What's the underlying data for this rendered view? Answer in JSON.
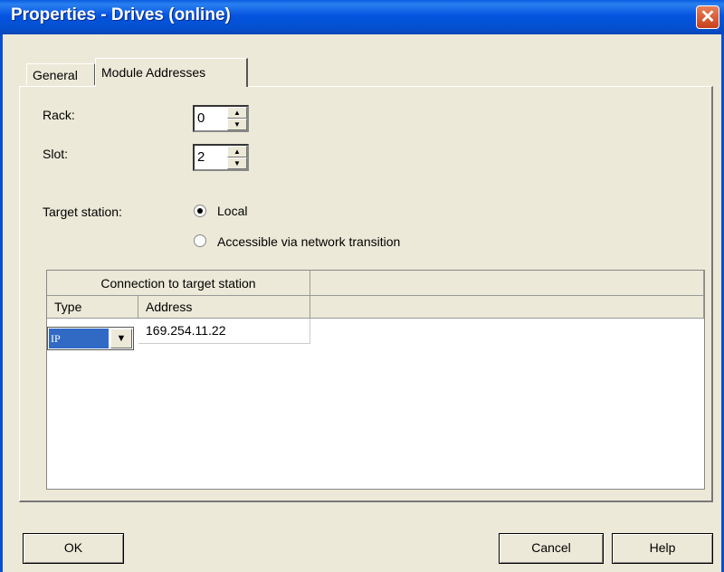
{
  "window": {
    "title": "Properties - Drives (online)",
    "close_icon": "close-icon"
  },
  "tabs": [
    {
      "label": "General",
      "active": false
    },
    {
      "label": "Module Addresses",
      "active": true
    }
  ],
  "rack": {
    "label": "Rack:",
    "value": "0"
  },
  "slot": {
    "label": "Slot:",
    "value": "2"
  },
  "target": {
    "label": "Target station:",
    "options": [
      {
        "label": "Local",
        "checked": true
      },
      {
        "label": "Accessible via network transition",
        "checked": false
      }
    ]
  },
  "table": {
    "group_header": "Connection to target station",
    "columns": [
      "Type",
      "Address"
    ],
    "rows": [
      {
        "type": "IP",
        "address": "169.254.11.22"
      }
    ]
  },
  "buttons": {
    "ok": "OK",
    "cancel": "Cancel",
    "help": "Help"
  }
}
